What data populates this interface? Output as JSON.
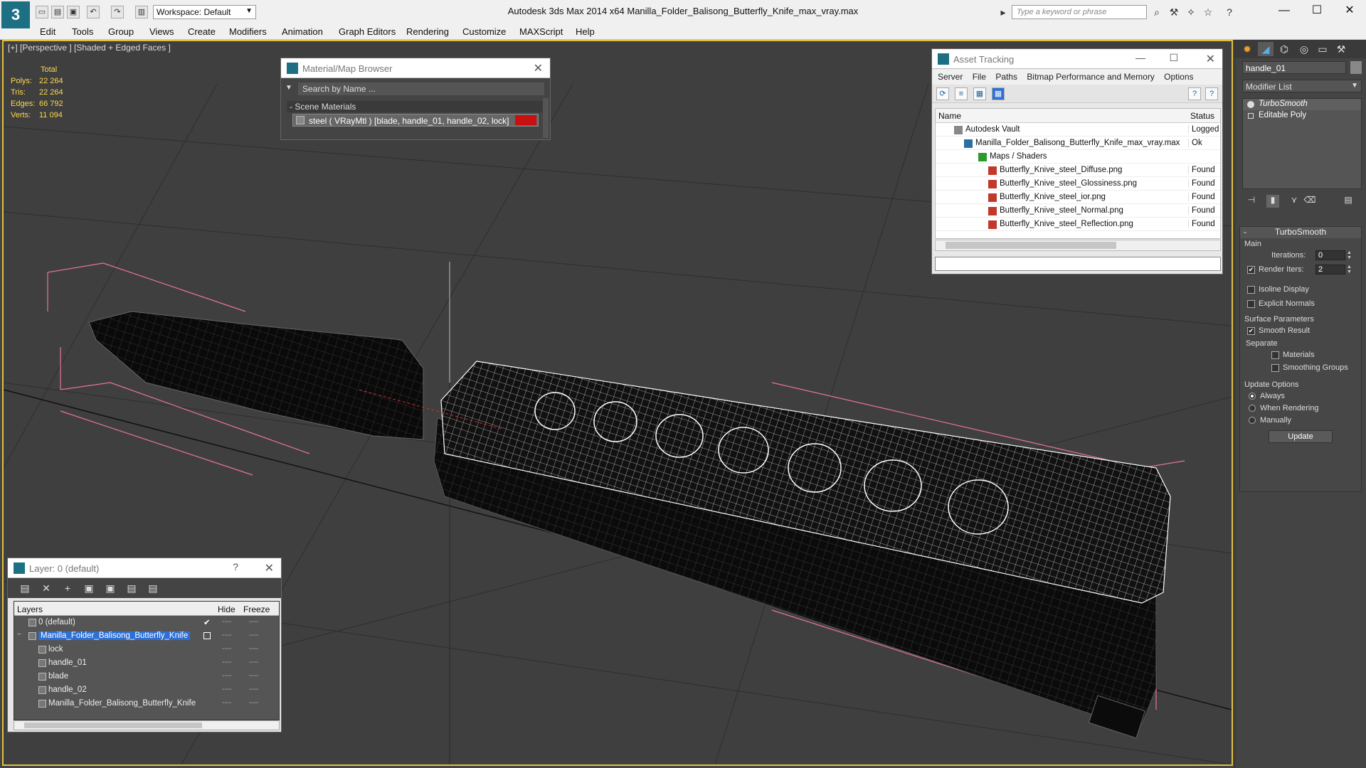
{
  "app": {
    "workspace_label": "Workspace: Default",
    "title": "Autodesk 3ds Max  2014 x64     Manilla_Folder_Balisong_Butterfly_Knife_max_vray.max",
    "search_placeholder": "Type a keyword or phrase"
  },
  "menu": [
    "Edit",
    "Tools",
    "Group",
    "Views",
    "Create",
    "Modifiers",
    "Animation",
    "Graph Editors",
    "Rendering",
    "Customize",
    "MAXScript",
    "Help"
  ],
  "viewport": {
    "label": "[+] [Perspective ] [Shaded + Edged Faces ]",
    "stats": {
      "total_label": "Total",
      "rows": [
        {
          "label": "Polys:",
          "value": "22 264"
        },
        {
          "label": "Tris:",
          "value": "22 264"
        },
        {
          "label": "Edges:",
          "value": "66 792"
        },
        {
          "label": "Verts:",
          "value": "11 094"
        }
      ]
    }
  },
  "material_browser": {
    "title": "Material/Map Browser",
    "search_placeholder": "Search by Name ...",
    "section": "- Scene Materials",
    "material": "steel  ( VRayMtl )  [blade, handle_01, handle_02, lock]",
    "swatch_color": "#c81010"
  },
  "asset_tracking": {
    "title": "Asset Tracking",
    "menu": [
      "Server",
      "File",
      "Paths",
      "Bitmap Performance and Memory",
      "Options"
    ],
    "columns": {
      "name": "Name",
      "status": "Status"
    },
    "rows": [
      {
        "name": "Autodesk Vault",
        "status": "Logged Out",
        "indent": 0,
        "icon": "vault-icon"
      },
      {
        "name": "Manilla_Folder_Balisong_Butterfly_Knife_max_vray.max",
        "status": "Ok",
        "indent": 1,
        "icon": "max-file-icon"
      },
      {
        "name": "Maps / Shaders",
        "status": "",
        "indent": 2,
        "icon": "maps-icon"
      },
      {
        "name": "Butterfly_Knive_steel_Diffuse.png",
        "status": "Found",
        "indent": 3,
        "icon": "png-icon"
      },
      {
        "name": "Butterfly_Knive_steel_Glossiness.png",
        "status": "Found",
        "indent": 3,
        "icon": "png-icon"
      },
      {
        "name": "Butterfly_Knive_steel_ior.png",
        "status": "Found",
        "indent": 3,
        "icon": "png-icon"
      },
      {
        "name": "Butterfly_Knive_steel_Normal.png",
        "status": "Found",
        "indent": 3,
        "icon": "png-icon"
      },
      {
        "name": "Butterfly_Knive_steel_Reflection.png",
        "status": "Found",
        "indent": 3,
        "icon": "png-icon"
      }
    ]
  },
  "layer_dialog": {
    "title": "Layer: 0 (default)",
    "help": "?",
    "columns": {
      "layers": "Layers",
      "hide": "Hide",
      "freeze": "Freeze"
    },
    "rows": [
      {
        "name": "0 (default)",
        "indent": 0,
        "selected": false,
        "hide": "----",
        "freeze": "----"
      },
      {
        "name": "Manilla_Folder_Balisong_Butterfly_Knife",
        "indent": 0,
        "selected": true,
        "hide": "----",
        "freeze": "----"
      },
      {
        "name": "lock",
        "indent": 1,
        "selected": false,
        "hide": "----",
        "freeze": "----"
      },
      {
        "name": "handle_01",
        "indent": 1,
        "selected": false,
        "hide": "----",
        "freeze": "----"
      },
      {
        "name": "blade",
        "indent": 1,
        "selected": false,
        "hide": "----",
        "freeze": "----"
      },
      {
        "name": "handle_02",
        "indent": 1,
        "selected": false,
        "hide": "----",
        "freeze": "----"
      },
      {
        "name": "Manilla_Folder_Balisong_Butterfly_Knife",
        "indent": 1,
        "selected": false,
        "hide": "----",
        "freeze": "----"
      }
    ]
  },
  "command_panel": {
    "object_name": "handle_01",
    "modifier_list": "Modifier List",
    "stack": [
      {
        "name": "TurboSmooth",
        "active": true
      },
      {
        "name": "Editable Poly",
        "active": false
      }
    ],
    "turbosmooth": {
      "title": "TurboSmooth",
      "main": "Main",
      "iterations_label": "Iterations:",
      "iterations": "0",
      "render_iters_label": "Render Iters:",
      "render_iters": "2",
      "render_iters_checked": true,
      "isoline": "Isoline Display",
      "explicit_normals": "Explicit Normals",
      "surface_params": "Surface Parameters",
      "smooth_result": "Smooth Result",
      "smooth_result_checked": true,
      "separate": "Separate",
      "materials": "Materials",
      "smoothing_groups": "Smoothing Groups",
      "update_options": "Update Options",
      "always": "Always",
      "when_rendering": "When Rendering",
      "manually": "Manually",
      "selected_update": "always",
      "update_button": "Update"
    }
  }
}
